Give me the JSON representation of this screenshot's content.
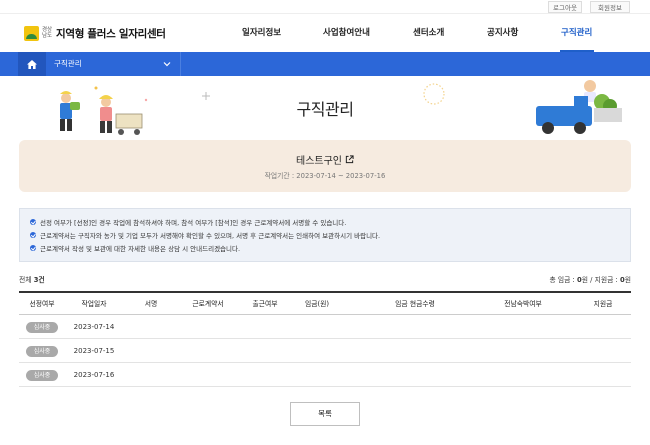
{
  "util": {
    "logout": "로그아웃",
    "member_info": "회원정보"
  },
  "header": {
    "logo_small": "경상 남도",
    "logo_text": "지역형 플러스 일자리센터",
    "nav": [
      "일자리정보",
      "사업참여안내",
      "센터소개",
      "공지사항",
      "구직관리"
    ],
    "active_nav": "구직관리"
  },
  "location": {
    "current": "구직관리"
  },
  "hero": {
    "title": "구직관리"
  },
  "job": {
    "name": "테스트구인",
    "period": "작업기간 : 2023-07-14 ~ 2023-07-16"
  },
  "notices": [
    "선정 여부가 [선정]인 경우 작업에 참석하셔야 하며, 참석 여부가 [참석]인 경우 근로계약서에 서명할 수 있습니다.",
    "근로계약서는 구직자와 농가 및 기업 모두가 서명해야 확인할 수 있으며, 서명 후 근로계약서는 인쇄하여 보관하시기 바랍니다.",
    "근로계약서 작성 및 보관에 대한 자세한 내용은 상담 시 안내드리겠습니다."
  ],
  "counts": {
    "total_label": "전체",
    "total_value": "3건",
    "wage_label": "총 임금 :",
    "wage_value": "0",
    "wage_unit": "원 / 지원금 :",
    "support_value": "0",
    "support_unit": "원"
  },
  "table": {
    "headers": [
      "선정여부",
      "작업일자",
      "서명",
      "근로계약서",
      "출근여부",
      "임금(원)",
      "임금 현금수령",
      "전남숙박여부",
      "지원금"
    ],
    "rows": [
      {
        "status": "심사중",
        "date": "2023-07-14"
      },
      {
        "status": "심사중",
        "date": "2023-07-15"
      },
      {
        "status": "심사중",
        "date": "2023-07-16"
      }
    ]
  },
  "list_button": "목록",
  "colors": {
    "primary": "#2c67d8",
    "card_bg": "#f6ebe0",
    "badge": "#a9a9a9"
  }
}
